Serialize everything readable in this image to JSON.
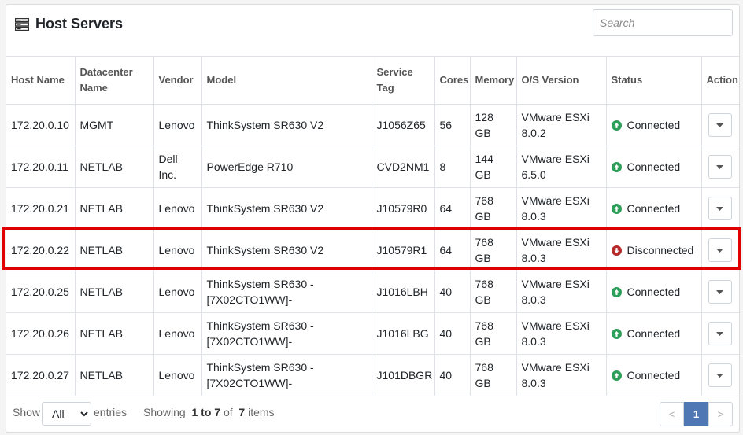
{
  "header": {
    "title": "Host Servers",
    "icon": "server-icon"
  },
  "search": {
    "placeholder": "Search"
  },
  "columns": [
    "Host Name",
    "Datacenter Name",
    "Vendor",
    "Model",
    "Service Tag",
    "Cores",
    "Memory",
    "O/S Version",
    "Status",
    "Action"
  ],
  "rows": [
    {
      "host": "172.20.0.10",
      "datacenter": "MGMT",
      "vendor": "Lenovo",
      "model": "ThinkSystem SR630 V2",
      "tag": "J1056Z65",
      "cores": "56",
      "memory": "128 GB",
      "os": "VMware ESXi 8.0.2",
      "status": "Connected"
    },
    {
      "host": "172.20.0.11",
      "datacenter": "NETLAB",
      "vendor": "Dell Inc.",
      "model": "PowerEdge R710",
      "tag": "CVD2NM1",
      "cores": "8",
      "memory": "144 GB",
      "os": "VMware ESXi 6.5.0",
      "status": "Connected"
    },
    {
      "host": "172.20.0.21",
      "datacenter": "NETLAB",
      "vendor": "Lenovo",
      "model": "ThinkSystem SR630 V2",
      "tag": "J10579R0",
      "cores": "64",
      "memory": "768 GB",
      "os": "VMware ESXi 8.0.3",
      "status": "Connected"
    },
    {
      "host": "172.20.0.22",
      "datacenter": "NETLAB",
      "vendor": "Lenovo",
      "model": "ThinkSystem SR630 V2",
      "tag": "J10579R1",
      "cores": "64",
      "memory": "768 GB",
      "os": "VMware ESXi 8.0.3",
      "status": "Disconnected"
    },
    {
      "host": "172.20.0.25",
      "datacenter": "NETLAB",
      "vendor": "Lenovo",
      "model": "ThinkSystem SR630 -[7X02CTO1WW]-",
      "tag": "J1016LBH",
      "cores": "40",
      "memory": "768 GB",
      "os": "VMware ESXi 8.0.3",
      "status": "Connected"
    },
    {
      "host": "172.20.0.26",
      "datacenter": "NETLAB",
      "vendor": "Lenovo",
      "model": "ThinkSystem SR630 -[7X02CTO1WW]-",
      "tag": "J1016LBG",
      "cores": "40",
      "memory": "768 GB",
      "os": "VMware ESXi 8.0.3",
      "status": "Connected"
    },
    {
      "host": "172.20.0.27",
      "datacenter": "NETLAB",
      "vendor": "Lenovo",
      "model": "ThinkSystem SR630 -[7X02CTO1WW]-",
      "tag": "J101DBGR",
      "cores": "40",
      "memory": "768 GB",
      "os": "VMware ESXi 8.0.3",
      "status": "Connected"
    }
  ],
  "status_colors": {
    "Connected": "#2e9e5b",
    "Disconnected": "#b52a2a"
  },
  "highlight_color": "#e00000",
  "footer": {
    "show_label": "Show",
    "page_size": "All",
    "entries_label": "entries",
    "showing_label": "Showing",
    "range": "1 to 7",
    "of_label": "of",
    "total": "7",
    "items_label": "items"
  },
  "pagination": {
    "prev": "<",
    "current": "1",
    "next": ">"
  }
}
